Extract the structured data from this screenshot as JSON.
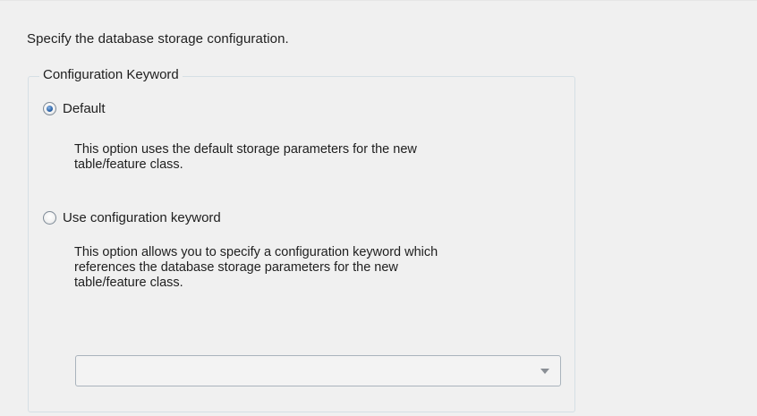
{
  "instruction": "Specify the database storage configuration.",
  "group": {
    "legend": "Configuration Keyword",
    "options": [
      {
        "label": "Default",
        "selected": true,
        "description_lines": [
          "This option uses the default storage parameters for the new",
          "table/feature class."
        ]
      },
      {
        "label": "Use configuration keyword",
        "selected": false,
        "description_lines": [
          "This option allows you to specify a configuration keyword which",
          "references the database storage parameters for the new",
          "table/feature class."
        ]
      }
    ],
    "keyword_dropdown": {
      "selected_value": "",
      "enabled": false,
      "icon": "chevron-down-icon"
    }
  }
}
